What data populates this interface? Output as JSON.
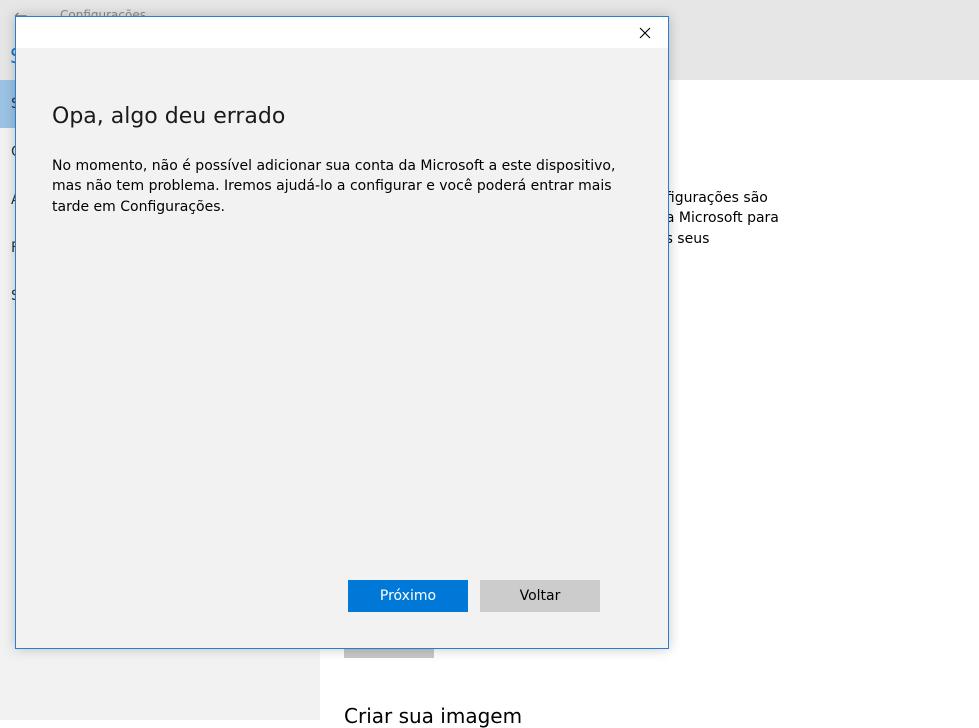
{
  "background_window": {
    "back_icon": "back-arrow-icon",
    "title": "Configurações",
    "app_letter": "S",
    "sidebar_letters": [
      "S",
      "O",
      "A",
      "F",
      "S"
    ],
    "description_lines": [
      "nfigurações são",
      "da Microsoft para",
      "os seus"
    ],
    "subheading": "Criar sua imagem"
  },
  "dialog": {
    "close_icon": "close-icon",
    "heading": "Opa, algo deu errado",
    "message_lines": [
      "No momento, não é possível adicionar sua conta da Microsoft a este dispositivo,",
      "mas não tem problema. Iremos ajudá-lo a configurar e você poderá entrar mais",
      "tarde em Configurações."
    ],
    "primary_button": "Próximo",
    "secondary_button": "Voltar"
  },
  "colors": {
    "accent": "#0078d7",
    "dialog_border": "#2b7cd3",
    "secondary_button": "#cccccc"
  }
}
